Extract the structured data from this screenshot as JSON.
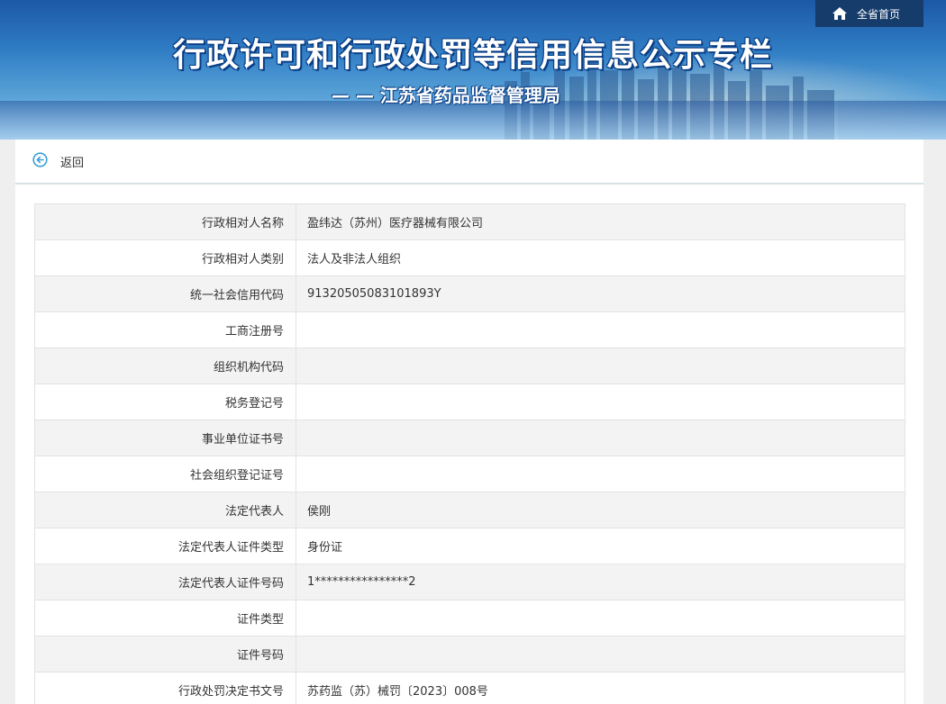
{
  "header": {
    "title": "行政许可和行政处罚等信用信息公示专栏",
    "subtitle": "— — 江苏省药品监督管理局",
    "home_label": "全省首页",
    "home_icon": "home-icon"
  },
  "nav": {
    "back_label": "返回",
    "back_icon": "circle-arrow-left-icon"
  },
  "colors": {
    "banner_blue": "#2f7cc4",
    "home_button_bg": "#163c6b",
    "back_icon": "#3aa0d8",
    "row_alt_bg": "#f3f3f3"
  },
  "details": {
    "rows": [
      {
        "label": "行政相对人名称",
        "value": "盈纬达（苏州）医疗器械有限公司"
      },
      {
        "label": "行政相对人类别",
        "value": "法人及非法人组织"
      },
      {
        "label": "统一社会信用代码",
        "value": "91320505083101893Y"
      },
      {
        "label": "工商注册号",
        "value": ""
      },
      {
        "label": "组织机构代码",
        "value": ""
      },
      {
        "label": "税务登记号",
        "value": ""
      },
      {
        "label": "事业单位证书号",
        "value": ""
      },
      {
        "label": "社会组织登记证号",
        "value": ""
      },
      {
        "label": "法定代表人",
        "value": "侯刚"
      },
      {
        "label": "法定代表人证件类型",
        "value": "身份证"
      },
      {
        "label": "法定代表人证件号码",
        "value": "1****************2"
      },
      {
        "label": "证件类型",
        "value": ""
      },
      {
        "label": "证件号码",
        "value": ""
      },
      {
        "label": "行政处罚决定书文号",
        "value": "苏药监（苏）械罚〔2023〕008号"
      }
    ]
  }
}
